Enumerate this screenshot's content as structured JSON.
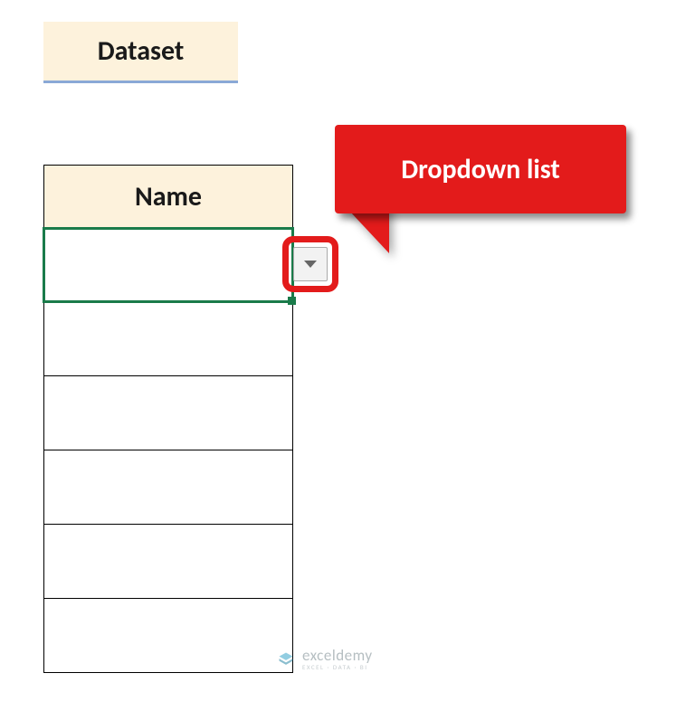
{
  "title": "Dataset",
  "table": {
    "header": "Name",
    "rows": [
      "",
      "",
      "",
      "",
      "",
      ""
    ]
  },
  "callout": {
    "label": "Dropdown list"
  },
  "watermark": {
    "brand": "exceldemy",
    "sub": "EXCEL · DATA · BI"
  }
}
